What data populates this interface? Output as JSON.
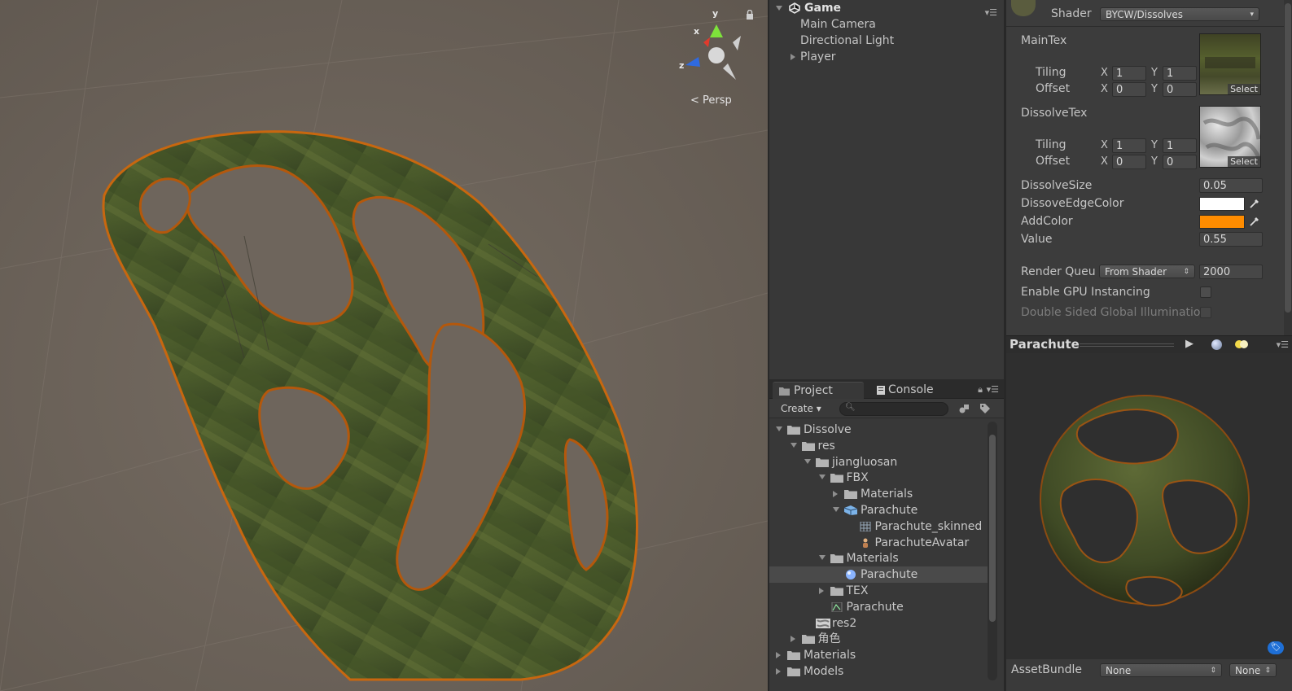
{
  "scene": {
    "gizmo_axes": {
      "y": "y",
      "x": "x",
      "z": "z"
    },
    "projection_label": "Persp",
    "colors": {
      "ground": "#6e655c",
      "cloth": "#4b5a2c",
      "burn_edge": "#c8670f"
    }
  },
  "hierarchy": {
    "root_label": "Game",
    "items": [
      {
        "label": "Main Camera",
        "expandable": false
      },
      {
        "label": "Directional Light",
        "expandable": false
      },
      {
        "label": "Player",
        "expandable": true
      }
    ]
  },
  "project": {
    "tabs": [
      {
        "label": "Project",
        "active": true,
        "icon": "folder-icon"
      },
      {
        "label": "Console",
        "active": false,
        "icon": "console-icon"
      }
    ],
    "create_label": "Create ▾",
    "search_placeholder": "",
    "tree": [
      {
        "label": "Dissolve",
        "depth": 0,
        "state": "expanded",
        "icon": "folder-icon"
      },
      {
        "label": "res",
        "depth": 1,
        "state": "expanded",
        "icon": "folder-icon"
      },
      {
        "label": "jiangluosan",
        "depth": 2,
        "state": "expanded",
        "icon": "folder-icon"
      },
      {
        "label": "FBX",
        "depth": 3,
        "state": "expanded",
        "icon": "folder-icon"
      },
      {
        "label": "Materials",
        "depth": 4,
        "state": "collapsed",
        "icon": "folder-icon"
      },
      {
        "label": "Parachute",
        "depth": 4,
        "state": "expanded",
        "icon": "model-icon"
      },
      {
        "label": "Parachute_skinned",
        "depth": 5,
        "state": "none",
        "icon": "mesh-icon"
      },
      {
        "label": "ParachuteAvatar",
        "depth": 5,
        "state": "none",
        "icon": "avatar-icon"
      },
      {
        "label": "Materials",
        "depth": 3,
        "state": "expanded",
        "icon": "folder-icon"
      },
      {
        "label": "Parachute",
        "depth": 4,
        "state": "none",
        "icon": "material-icon",
        "selected": true
      },
      {
        "label": "TEX",
        "depth": 3,
        "state": "collapsed",
        "icon": "folder-icon"
      },
      {
        "label": "Parachute",
        "depth": 3,
        "state": "none",
        "icon": "prefab-icon"
      },
      {
        "label": "res2",
        "depth": 2,
        "state": "none",
        "icon": "texture-icon"
      },
      {
        "label": "角色",
        "depth": 1,
        "state": "collapsed",
        "icon": "folder-icon"
      },
      {
        "label": "Materials",
        "depth": 0,
        "state": "collapsed",
        "icon": "folder-icon"
      },
      {
        "label": "Models",
        "depth": 0,
        "state": "collapsed",
        "icon": "folder-icon"
      }
    ]
  },
  "inspector": {
    "shader_label": "Shader",
    "shader_value": "BYCW/Dissolves",
    "main_tex": {
      "label": "MainTex",
      "tiling_label": "Tiling",
      "offset_label": "Offset",
      "tiling_x": "1",
      "tiling_y": "1",
      "offset_x": "0",
      "offset_y": "0",
      "select_label": "Select"
    },
    "dissolve_tex": {
      "label": "DissolveTex",
      "tiling_label": "Tiling",
      "offset_label": "Offset",
      "tiling_x": "1",
      "tiling_y": "1",
      "offset_x": "0",
      "offset_y": "0",
      "select_label": "Select"
    },
    "axis_x": "X",
    "axis_y": "Y",
    "dissolve_size": {
      "label": "DissolveSize",
      "value": "0.05"
    },
    "edge_color": {
      "label": "DissoveEdgeColor",
      "color": "#ffffff"
    },
    "add_color": {
      "label": "AddColor",
      "color": "#ff8c00"
    },
    "value": {
      "label": "Value",
      "value": "0.55"
    },
    "render_queue": {
      "label": "Render Queu",
      "mode": "From Shader",
      "value": "2000"
    },
    "gpu_instancing": {
      "label": "Enable GPU Instancing",
      "checked": false
    },
    "double_sided": {
      "label": "Double Sided Global Illuminatio",
      "checked": false
    }
  },
  "preview": {
    "title": "Parachute"
  },
  "asset_bundle": {
    "label": "AssetBundle",
    "name_value": "None",
    "variant_value": "None"
  }
}
